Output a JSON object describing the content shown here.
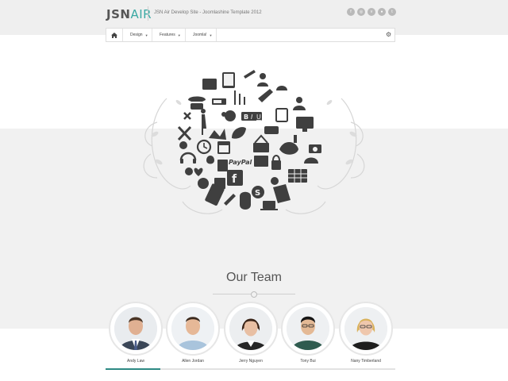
{
  "header": {
    "logo_part1": "JSN",
    "logo_part2": "AIR",
    "tagline": "JSN Air Develop Site - Joomlashine Template 2012",
    "social_icons": [
      "facebook-icon",
      "dribbble-icon",
      "vimeo-icon",
      "flickr-icon",
      "twitter-icon"
    ]
  },
  "nav": {
    "items": [
      {
        "label": "",
        "icon": "home-icon"
      },
      {
        "label": "Design",
        "icon": "camera-icon"
      },
      {
        "label": "Features",
        "icon": "globe-icon"
      },
      {
        "label": "Joomla!",
        "icon": "list-icon"
      }
    ],
    "settings_icon": "gear-icon"
  },
  "hero": {
    "icon_cloud_labels": [
      "PayPal",
      "B",
      "I",
      "U"
    ]
  },
  "team": {
    "title": "Our Team",
    "members": [
      {
        "name": "Andy Law"
      },
      {
        "name": "Allen Jordan"
      },
      {
        "name": "Jerry Nguyen"
      },
      {
        "name": "Tony Bui"
      },
      {
        "name": "Nany Timberland"
      }
    ],
    "active_index": 0
  },
  "colors": {
    "accent": "#3aa9a3",
    "active_tab": "#2e8a84",
    "top_bar": "#efefef",
    "band_grey": "#f1f1f1",
    "icon_dark": "#3f3f3f"
  }
}
